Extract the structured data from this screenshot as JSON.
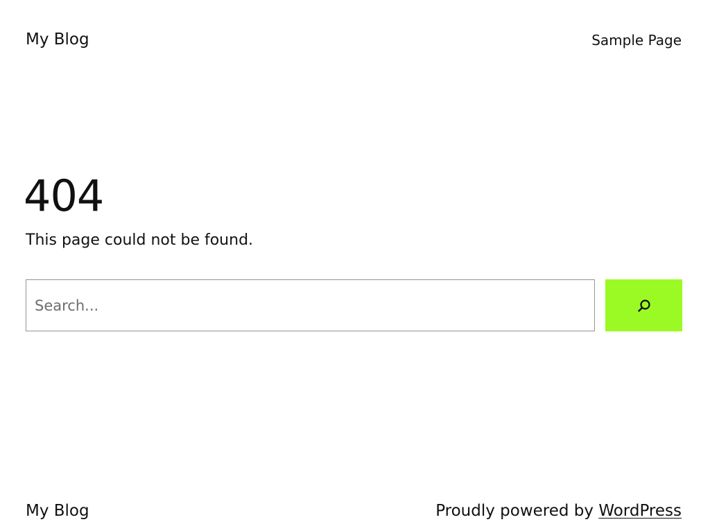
{
  "header": {
    "site_title": "My Blog",
    "nav_items": [
      {
        "label": "Sample Page"
      }
    ]
  },
  "main": {
    "error_code": "404",
    "message": "This page could not be found.",
    "search": {
      "value": "",
      "placeholder": "Search...",
      "button_icon": "search-icon"
    }
  },
  "footer": {
    "site_title": "My Blog",
    "credit_prefix": "Proudly powered by",
    "credit_link": "WordPress"
  },
  "colors": {
    "accent": "#9bfa24",
    "text": "#111111",
    "background": "#ffffff",
    "input_border": "#949494"
  }
}
